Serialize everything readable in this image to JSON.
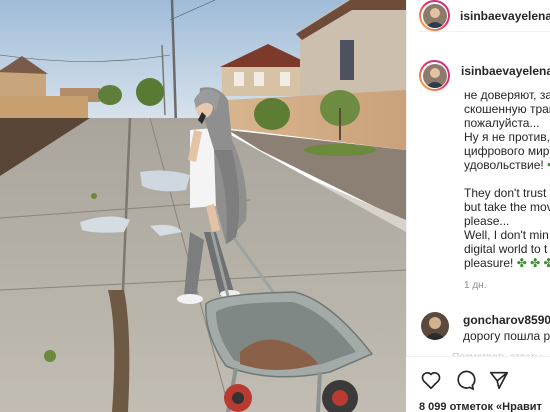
{
  "post": {
    "username": "isinbaevayelena",
    "caption_lines": [
      "не доверяют, за",
      "скошенную трав",
      "пожалуйста...",
      "Ну я не против,",
      "цифрового мир",
      "удовольствие! ✤",
      "",
      "They don't trust",
      "but take the mov",
      "please...",
      "Well, I don't min",
      "digital world to t",
      "pleasure! ✤ ✤ ✤"
    ],
    "time_ago": "1 дн."
  },
  "comment": {
    "username": "goncharov8590",
    "text": "дорогу пошла р",
    "more": "Посмотреть ответы"
  },
  "likes": {
    "count": "8 099",
    "text": "отметок «Нравит"
  },
  "icons": {
    "like": "heart-icon",
    "comment": "comment-icon",
    "share": "share-icon"
  },
  "colors": {
    "sky": "#b9cde0",
    "concrete": "#b5b1a8",
    "story_ring": "#e1306c",
    "wheelbarrow": "#8a9590"
  }
}
